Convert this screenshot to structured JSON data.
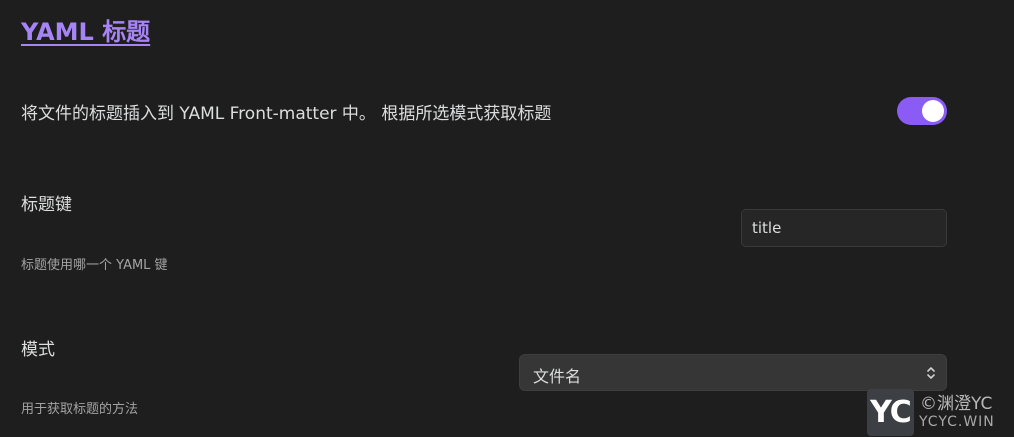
{
  "section": {
    "title": "YAML 标题"
  },
  "enable_setting": {
    "description": "将文件的标题插入到 YAML Front-matter 中。 根据所选模式获取标题",
    "toggle_on": true
  },
  "title_key_setting": {
    "name": "标题键",
    "description": "标题使用哪一个 YAML 键",
    "value": "title"
  },
  "mode_setting": {
    "name": "模式",
    "description": "用于获取标题的方法",
    "selected": "文件名"
  },
  "watermark": {
    "logo_text": "YC",
    "line1": "©渊澄YC",
    "line2": "YCYC.WIN"
  },
  "colors": {
    "background": "#1e1e1e",
    "accent": "#8a5cf5",
    "link": "#a684f5"
  }
}
